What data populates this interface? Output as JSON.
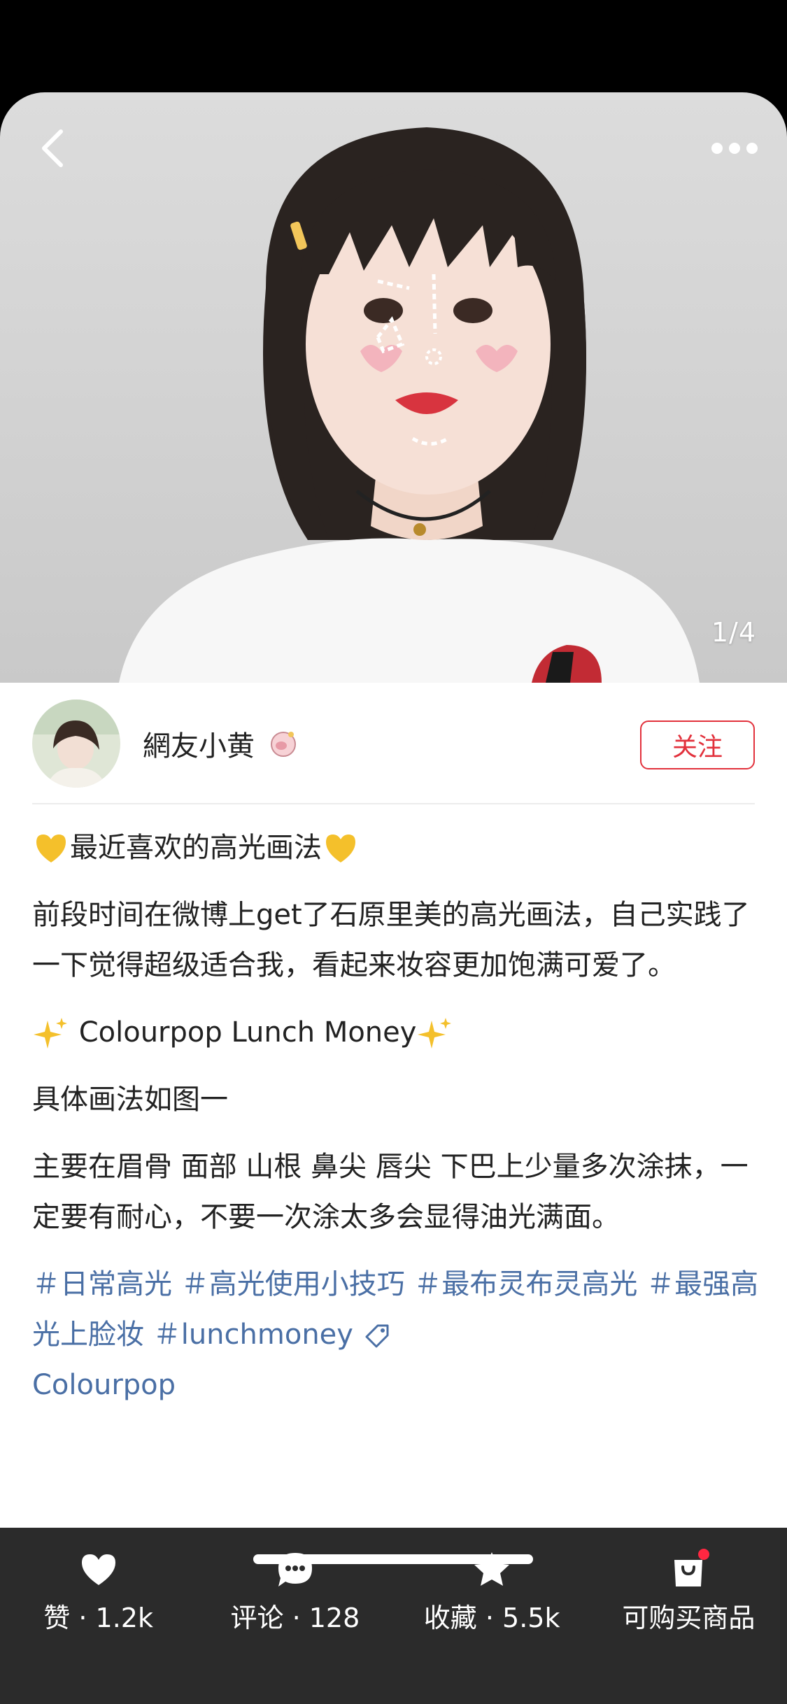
{
  "hero": {
    "counter": "1/4"
  },
  "author": {
    "name": "網友小黄",
    "follow_label": "关注"
  },
  "post": {
    "title": "最近喜欢的高光画法",
    "paragraph1": "前段时间在微博上get了石原里美的高光画法，自己实践了一下觉得超级适合我，看起来妆容更加饱满可爱了。",
    "product": " Colourpop Lunch Money",
    "paragraph2": "具体画法如图一",
    "paragraph3": "主要在眉骨 面部 山根 鼻尖 唇尖 下巴上少量多次涂抹，一定要有耐心，不要一次涂太多会显得油光满面。",
    "tags": [
      "＃日常高光",
      "＃高光使用小技巧",
      "＃最布灵布灵高光",
      "＃最强高光上脸妆",
      "＃lunchmoney"
    ],
    "brand_tag": "Colourpop"
  },
  "bottom_bar": {
    "like_label": "赞 · 1.2k",
    "comment_label": "评论 · 128",
    "collect_label": "收藏 · 5.5k",
    "shop_label": "可购买商品"
  },
  "colors": {
    "accent_red": "#e2313c",
    "tag_blue": "#4a6fa5",
    "bar_bg": "#2b2b2b"
  },
  "icons": [
    "back-icon",
    "more-icon",
    "heart-emoji-icon",
    "sparkle-emoji-icon",
    "price-tag-icon",
    "like-icon",
    "comment-icon",
    "star-icon",
    "shopping-bag-icon",
    "badge-icon"
  ]
}
